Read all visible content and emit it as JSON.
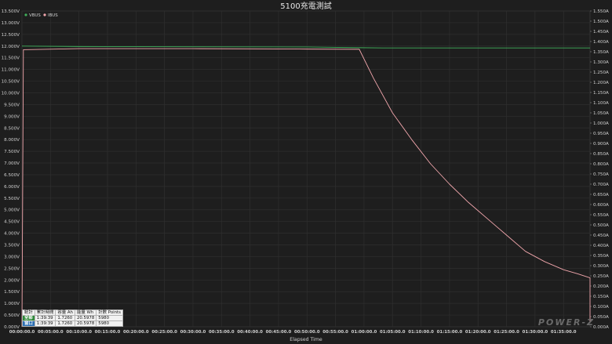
{
  "chart_data": {
    "type": "line",
    "title": "5100充電測試",
    "xlabel": "Elapsed Time",
    "x_unit": "seconds",
    "x_ticks": [
      "00:00:00.0",
      "00:05:00.0",
      "00:10:00.0",
      "00:15:00.0",
      "00:20:00.0",
      "00:25:00.0",
      "00:30:00.0",
      "00:35:00.0",
      "00:40:00.0",
      "00:45:00.0",
      "00:50:00.0",
      "00:55:00.0",
      "01:00:00.0",
      "01:05:00.0",
      "01:10:00.0",
      "01:15:00.0",
      "01:20:00.0",
      "01:25:00.0",
      "01:30:00.0",
      "01:35:00.0"
    ],
    "xlim": [
      0,
      5979
    ],
    "y_left": {
      "unit": "V",
      "lim": [
        0,
        13.5
      ],
      "ticks": [
        "0.000V",
        "0.500V",
        "1.000V",
        "1.500V",
        "2.000V",
        "2.500V",
        "3.000V",
        "3.500V",
        "4.000V",
        "4.500V",
        "5.000V",
        "5.500V",
        "6.000V",
        "6.500V",
        "7.000V",
        "7.500V",
        "8.000V",
        "8.500V",
        "9.000V",
        "9.500V",
        "10.000V",
        "10.500V",
        "11.000V",
        "11.500V",
        "12.000V",
        "12.500V",
        "13.000V",
        "13.500V"
      ]
    },
    "y_right": {
      "unit": "A",
      "lim": [
        0,
        1.55
      ],
      "ticks": [
        "0.000A",
        "0.050A",
        "0.100A",
        "0.150A",
        "0.200A",
        "0.250A",
        "0.300A",
        "0.350A",
        "0.400A",
        "0.450A",
        "0.500A",
        "0.550A",
        "0.600A",
        "0.650A",
        "0.700A",
        "0.750A",
        "0.800A",
        "0.850A",
        "0.900A",
        "0.950A",
        "1.000A",
        "1.050A",
        "1.100A",
        "1.150A",
        "1.200A",
        "1.250A",
        "1.300A",
        "1.350A",
        "1.400A",
        "1.450A",
        "1.500A",
        "1.550A"
      ]
    },
    "grid": true,
    "legend_position": "top-left",
    "series": [
      {
        "name": "VBUS",
        "axis": "left",
        "color": "#3fae5a",
        "points": [
          [
            0,
            12.0
          ],
          [
            10,
            12.0
          ],
          [
            600,
            11.98
          ],
          [
            1800,
            11.97
          ],
          [
            3000,
            11.96
          ],
          [
            3560,
            11.93
          ],
          [
            3800,
            11.92
          ],
          [
            4500,
            11.92
          ],
          [
            5400,
            11.92
          ],
          [
            5979,
            11.92
          ]
        ]
      },
      {
        "name": "IBUS",
        "axis": "right",
        "color": "#f2a7ad",
        "points": [
          [
            0,
            0.0
          ],
          [
            15,
            1.36
          ],
          [
            600,
            1.365
          ],
          [
            1800,
            1.365
          ],
          [
            3000,
            1.363
          ],
          [
            3550,
            1.362
          ],
          [
            3700,
            1.22
          ],
          [
            3900,
            1.05
          ],
          [
            4100,
            0.92
          ],
          [
            4300,
            0.8
          ],
          [
            4500,
            0.7
          ],
          [
            4700,
            0.61
          ],
          [
            4900,
            0.53
          ],
          [
            5100,
            0.45
          ],
          [
            5300,
            0.37
          ],
          [
            5500,
            0.32
          ],
          [
            5700,
            0.28
          ],
          [
            5850,
            0.26
          ],
          [
            5979,
            0.24
          ],
          [
            5979,
            0.02
          ]
        ]
      }
    ]
  },
  "stats": {
    "headers": [
      "統計",
      "累計時間",
      "容量 Ah",
      "能量 Wh",
      "計數 Points"
    ],
    "rows": [
      {
        "tag": "全部",
        "time": "1:39:39",
        "ah": "1.7260",
        "wh": "20.5978",
        "points": "5980"
      },
      {
        "tag": "窗口",
        "time": "1:39:39",
        "ah": "1.7260",
        "wh": "20.5978",
        "points": "5980"
      }
    ]
  },
  "brand": "POWER-Z"
}
